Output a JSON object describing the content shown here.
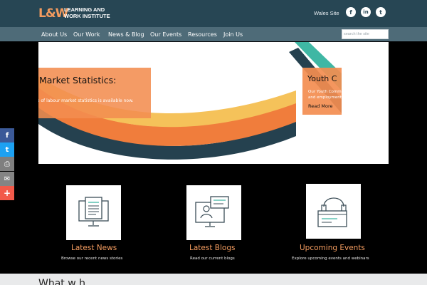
{
  "header": {
    "logo_mark": "L&W",
    "logo_line1": "LEARNING AND",
    "logo_line2": "WORK INSTITUTE",
    "wales_link": "Wales Site",
    "social": [
      "f",
      "in",
      "t"
    ]
  },
  "nav": {
    "items": [
      "About Us",
      "Our Work",
      "News & Blog",
      "Our Events",
      "Resources",
      "Join Us"
    ],
    "search_placeholder": "search the site"
  },
  "slides": {
    "left": {
      "title": "Market Statistics:",
      "text": "ysis of labour market statistics is available now."
    },
    "right": {
      "title": "Youth C",
      "text_line1": "Our Youth Comm",
      "text_line2": "and employment",
      "link": "Read More"
    }
  },
  "share_bar": {
    "icons": [
      "facebook-icon",
      "twitter-icon",
      "print-icon",
      "email-icon",
      "plus-icon"
    ],
    "glyphs": [
      "f",
      "t",
      "⎙",
      "✉",
      "+"
    ],
    "colors": [
      "#3b5998",
      "#1da1f2",
      "#7f7f7f",
      "#848484",
      "#f25a4a"
    ]
  },
  "features": [
    {
      "title": "Latest News",
      "subtitle": "Browse our recent news stories"
    },
    {
      "title": "Latest Blogs",
      "subtitle": "Read our current blogs"
    },
    {
      "title": "Upcoming Events",
      "subtitle": "Explore upcoming events and webinars"
    }
  ],
  "bottom": {
    "heading_fragment": "What w  h"
  },
  "colors": {
    "header_bg": "#274654",
    "nav_bg": "#4e6b78",
    "accent": "#f29b5f",
    "teal": "#3fb7a4",
    "dark_navy": "#25414f",
    "yellow": "#f5c25a"
  }
}
